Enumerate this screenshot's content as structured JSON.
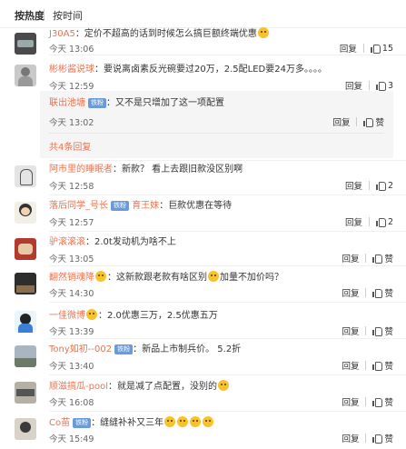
{
  "sort": {
    "hot": "按热度",
    "time": "按时间"
  },
  "comments": [
    {
      "user": "J30A5",
      "text": "定价不超高的话到时候怎么搞巨额终端优惠",
      "emoji": true,
      "time": "今天 13:06",
      "reply": "回复",
      "likes": "15"
    },
    {
      "user": "彬彬酱说球",
      "text": "要说离卤素反光碗要过20万，2.5配LED要24万多。。。。",
      "time": "今天 12:59",
      "reply": "回复",
      "likes": "3"
    },
    {
      "user": "阿市里的睡眠者",
      "text": "新款？ 看上去跟旧款没区别啊",
      "time": "今天 12:58",
      "reply": "回复",
      "likes": "2"
    },
    {
      "user": "落后同学_号长",
      "badge": "铁粉",
      "extra": "育王妹",
      "text": "巨款优惠在等待",
      "time": "今天 12:57",
      "reply": "回复",
      "likes": "2"
    },
    {
      "user": "驴滚滚滚",
      "text": "2.0t发动机为啥不上",
      "time": "今天 13:05",
      "reply": "回复",
      "likes": "赞"
    },
    {
      "user": "翻然销魂降",
      "text": "这新款跟老款有啥区别",
      "text2": "加量不加价吗？",
      "time": "今天 14:30",
      "reply": "回复",
      "likes": "赞"
    },
    {
      "user": "一佳微博",
      "text": "2.0优惠三万，2.5优惠五万",
      "time": "今天 13:39",
      "reply": "回复",
      "likes": "赞"
    },
    {
      "user": "Tony如初--002",
      "badge": "铁粉",
      "text": "新品上市制兵价。 5.2折",
      "time": "今天 13:40",
      "reply": "回复",
      "likes": "赞"
    },
    {
      "user": "顺滋搞瓜-pool",
      "text": "就是减了点配置，没别的",
      "time": "今天 16:08",
      "reply": "回复",
      "likes": "赞"
    },
    {
      "user": "Co苗",
      "badge": "铁粉",
      "text": "缝缝补补又三年",
      "time": "今天 15:49",
      "reply": "回复",
      "likes": "赞"
    }
  ],
  "subreply": {
    "user": "联出池塘",
    "badge": "铁粉",
    "text": "又不是只增加了这一项配置",
    "time": "今天 13:02",
    "reply": "回复",
    "likes": "赞",
    "more": "共4条回复"
  },
  "colors": {
    "username": "#eb7350",
    "badge": "#6a9bd8"
  }
}
